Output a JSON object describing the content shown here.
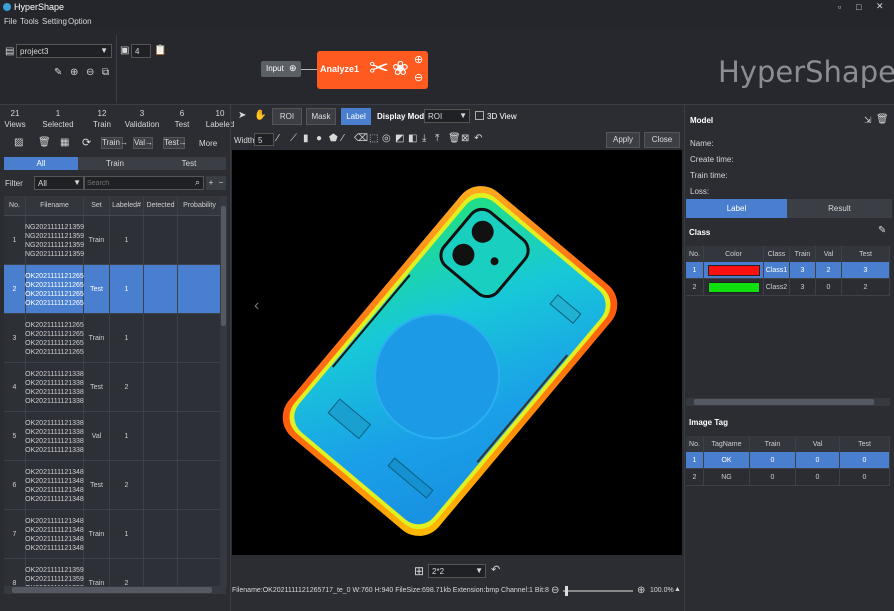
{
  "app": {
    "title": "HyperShape",
    "logo_text": "HyperShape"
  },
  "menu": [
    "File",
    "Tools",
    "Setting",
    "Option"
  ],
  "window_controls": {
    "min": "▫",
    "max": "□",
    "close": "✕"
  },
  "project": {
    "name": "project3",
    "spin_value": "4"
  },
  "pipeline": {
    "input_label": "Input",
    "analyze_label": "Analyze1"
  },
  "stats": [
    {
      "count": "21",
      "label": "Views"
    },
    {
      "count": "1",
      "label": "Selected"
    },
    {
      "count": "12",
      "label": "Train"
    },
    {
      "count": "3",
      "label": "Validation"
    },
    {
      "count": "6",
      "label": "Test"
    },
    {
      "count": "10",
      "label": "Labeled"
    }
  ],
  "left_toolbar": {
    "train": "Train",
    "val": "Val",
    "test": "Test",
    "more": "More"
  },
  "subset_tabs": [
    "All",
    "Train",
    "Test"
  ],
  "filter": {
    "label": "Filter",
    "value": "All",
    "search_placeholder": "Search"
  },
  "image_table": {
    "headers": [
      "No.",
      "Filename",
      "Set",
      "Labeled#",
      "Detected",
      "Probability"
    ],
    "rows": [
      {
        "no": "1",
        "lines": [
          "NG2021111121359",
          "NG2021111121359",
          "NG2021111121359",
          "NG2021111121359"
        ],
        "set": "Train",
        "labeled": "1"
      },
      {
        "no": "2",
        "lines": [
          "OK2021111121265",
          "OK2021111121265",
          "OK2021111121265",
          "OK2021111121265"
        ],
        "set": "Test",
        "labeled": "1"
      },
      {
        "no": "3",
        "lines": [
          "OK2021111121265",
          "OK2021111121265",
          "OK2021111121265",
          "OK2021111121265"
        ],
        "set": "Train",
        "labeled": "1"
      },
      {
        "no": "4",
        "lines": [
          "OK2021111121338",
          "OK2021111121338",
          "OK2021111121338",
          "OK2021111121338"
        ],
        "set": "Test",
        "labeled": "2"
      },
      {
        "no": "5",
        "lines": [
          "OK2021111121338",
          "OK2021111121338",
          "OK2021111121338",
          "OK2021111121338"
        ],
        "set": "Val",
        "labeled": "1"
      },
      {
        "no": "6",
        "lines": [
          "OK2021111121348",
          "OK2021111121348",
          "OK2021111121348",
          "OK2021111121348"
        ],
        "set": "Test",
        "labeled": "2"
      },
      {
        "no": "7",
        "lines": [
          "OK2021111121348",
          "OK2021111121348",
          "OK2021111121348",
          "OK2021111121348"
        ],
        "set": "Train",
        "labeled": "1"
      },
      {
        "no": "8",
        "lines": [
          "OK2021111121359",
          "OK2021111121359",
          "OK2021111121359",
          "OK2021111121359"
        ],
        "set": "Train",
        "labeled": "2"
      }
    ]
  },
  "center_toolbar": {
    "roi": "ROI",
    "mask": "Mask",
    "label": "Label",
    "display_mode_label": "Display Mode:",
    "display_mode_value": "ROI",
    "view3d": "3D View"
  },
  "draw_toolbar": {
    "width_label": "Width:",
    "width_value": "5",
    "apply": "Apply",
    "close": "Close"
  },
  "bottom": {
    "grid_value": "2*2",
    "status": "Filename:OK2021111121265717_te_0 W:760 H:940 FileSize:698.71kb Extension:bmp Channel:1 Bit:8",
    "zoom": "100.0%"
  },
  "model": {
    "title": "Model",
    "fields": [
      "Name:",
      "Create time:",
      "Train time:",
      "Loss:"
    ],
    "tabs": [
      "Label",
      "Result"
    ]
  },
  "class_section": {
    "title": "Class",
    "headers": [
      "No.",
      "Color",
      "Class",
      "Train",
      "Val",
      "Test"
    ],
    "rows": [
      {
        "no": "1",
        "color": "#ff1010",
        "name": "Class1",
        "train": "3",
        "val": "2",
        "test": "3"
      },
      {
        "no": "2",
        "color": "#10e010",
        "name": "Class2",
        "train": "3",
        "val": "0",
        "test": "2"
      }
    ]
  },
  "tag_section": {
    "title": "Image Tag",
    "headers": [
      "No.",
      "TagName",
      "Train",
      "Val",
      "Test"
    ],
    "rows": [
      {
        "no": "1",
        "name": "OK",
        "train": "0",
        "val": "0",
        "test": "0"
      },
      {
        "no": "2",
        "name": "NG",
        "train": "0",
        "val": "0",
        "test": "0"
      }
    ]
  },
  "colors": {
    "accent": "#4a7fd0",
    "analyze": "#ff5a1f",
    "background": "#2b2d33"
  }
}
